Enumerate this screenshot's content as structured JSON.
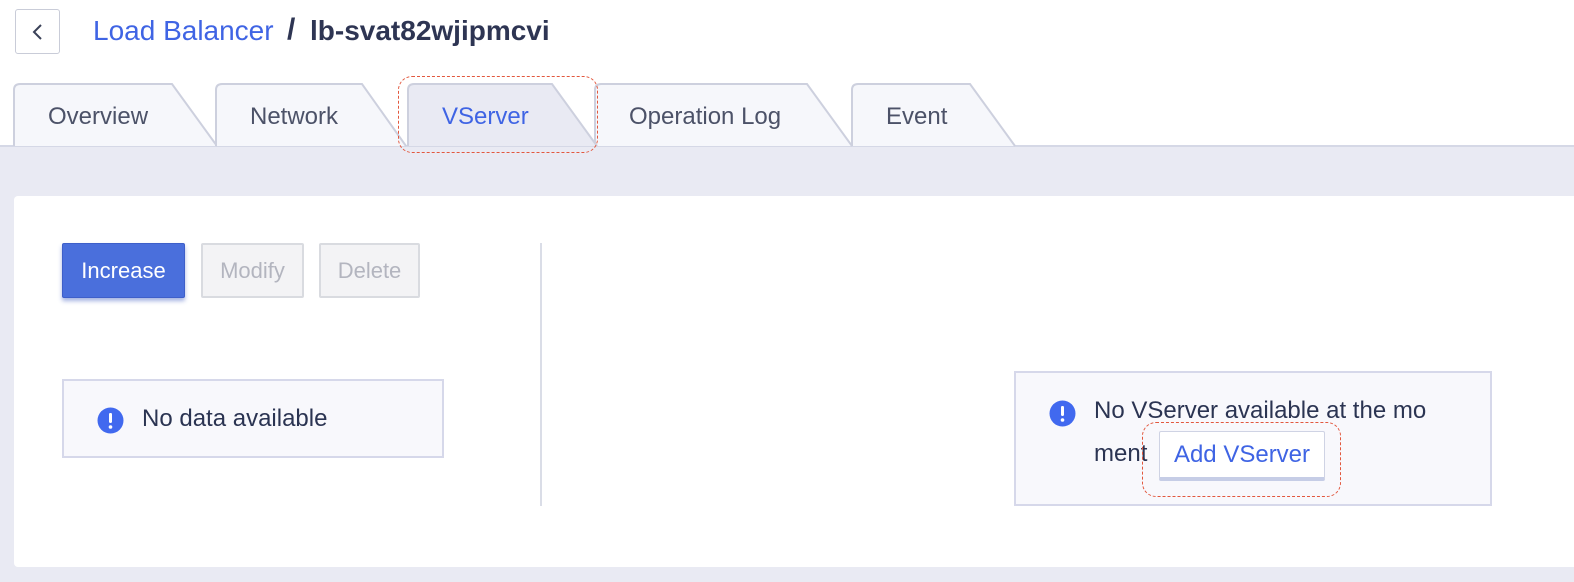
{
  "header": {
    "back_icon": "chevron-left-icon",
    "breadcrumb_root": "Load Balancer",
    "separator": "/",
    "current": "lb-svat82wjipmcvi"
  },
  "tabs": [
    {
      "label": "Overview",
      "active": false
    },
    {
      "label": "Network",
      "active": false
    },
    {
      "label": "VServer",
      "active": true
    },
    {
      "label": "Operation Log",
      "active": false
    },
    {
      "label": "Event",
      "active": false
    }
  ],
  "toolbar": {
    "increase_label": "Increase",
    "modify_label": "Modify",
    "delete_label": "Delete"
  },
  "left_panel": {
    "empty_icon": "info-icon",
    "empty_text": "No data available"
  },
  "right_panel": {
    "empty_icon": "info-icon",
    "empty_text_line1": "No VServer available at the mo",
    "empty_text_line2": "ment",
    "add_button_label": "Add VServer"
  },
  "colors": {
    "accent": "#3f64e4",
    "primary_button": "#4a6fdc",
    "page_background": "#e9eaf3",
    "highlight": "#e2583e"
  }
}
